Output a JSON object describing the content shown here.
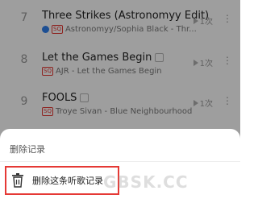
{
  "songs": [
    {
      "index": "7",
      "title": "Three Strikes (Astronomyy Edit)",
      "quality": "SQ",
      "artist_album": "Astronomyy/Sophia Black - Thr...",
      "plays": "1次",
      "verified": true
    },
    {
      "index": "8",
      "title": "Let the Games Begin",
      "quality": "SQ",
      "artist_album": "AJR - Let the Games Begin",
      "plays": "1次",
      "verified": false
    },
    {
      "index": "9",
      "title": "FOOLS",
      "quality": "SQ",
      "artist_album": "Troye Sivan - Blue Neighbourhood",
      "plays": "1次",
      "verified": false
    }
  ],
  "sheet": {
    "title": "删除记录",
    "action_label": "删除这条听歌记录"
  },
  "watermark": "GBSK.CC",
  "icons": {
    "play": "play-triangle-icon",
    "more": "more-dots-icon",
    "trash": "trash-icon"
  },
  "colors": {
    "highlight": "#e53935",
    "sq_badge": "#e53935",
    "verified": "#2f80ed"
  }
}
